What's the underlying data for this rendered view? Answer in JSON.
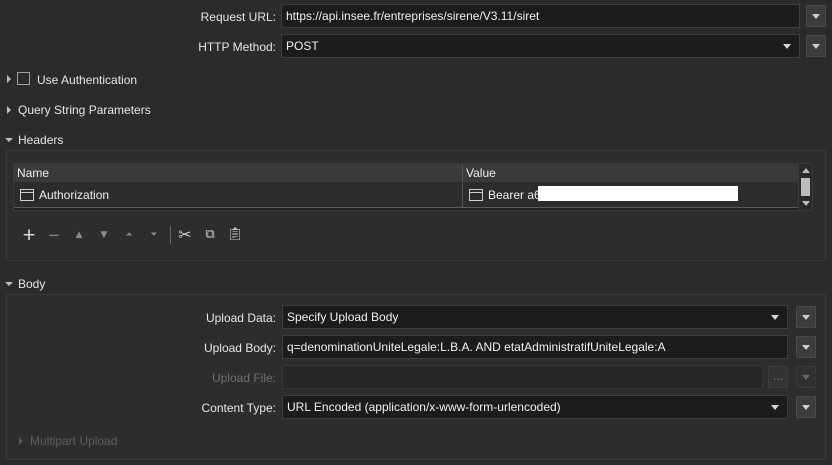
{
  "request": {
    "url_label": "Request URL:",
    "url_value": "https://api.insee.fr/entreprises/sirene/V3.11/siret",
    "method_label": "HTTP Method:",
    "method_value": "POST"
  },
  "sections": {
    "use_auth": "Use Authentication",
    "query_params": "Query String Parameters",
    "headers": "Headers",
    "body": "Body",
    "multipart": "Multipart Upload"
  },
  "headers_table": {
    "columns": [
      "Name",
      "Value"
    ],
    "rows": [
      {
        "name": "Authorization",
        "value": "Bearer a6c"
      }
    ]
  },
  "toolbar": {
    "icons": [
      "add-icon",
      "remove-icon",
      "move-up-icon",
      "move-down-icon",
      "move-top-icon",
      "move-bottom-icon",
      "cut-icon",
      "copy-icon",
      "paste-icon"
    ]
  },
  "body": {
    "upload_data_label": "Upload Data:",
    "upload_data_value": "Specify Upload Body",
    "upload_body_label": "Upload Body:",
    "upload_body_value": "q=denominationUniteLegale:L.B.A. AND etatAdministratifUniteLegale:A",
    "upload_file_label": "Upload File:",
    "upload_file_value": "",
    "browse_label": "...",
    "content_type_label": "Content Type:",
    "content_type_value": "URL Encoded (application/x-www-form-urlencoded)"
  },
  "colors": {
    "background": "#2b2b2b",
    "field": "#1c1c1c",
    "text": "#e6e6e6"
  }
}
